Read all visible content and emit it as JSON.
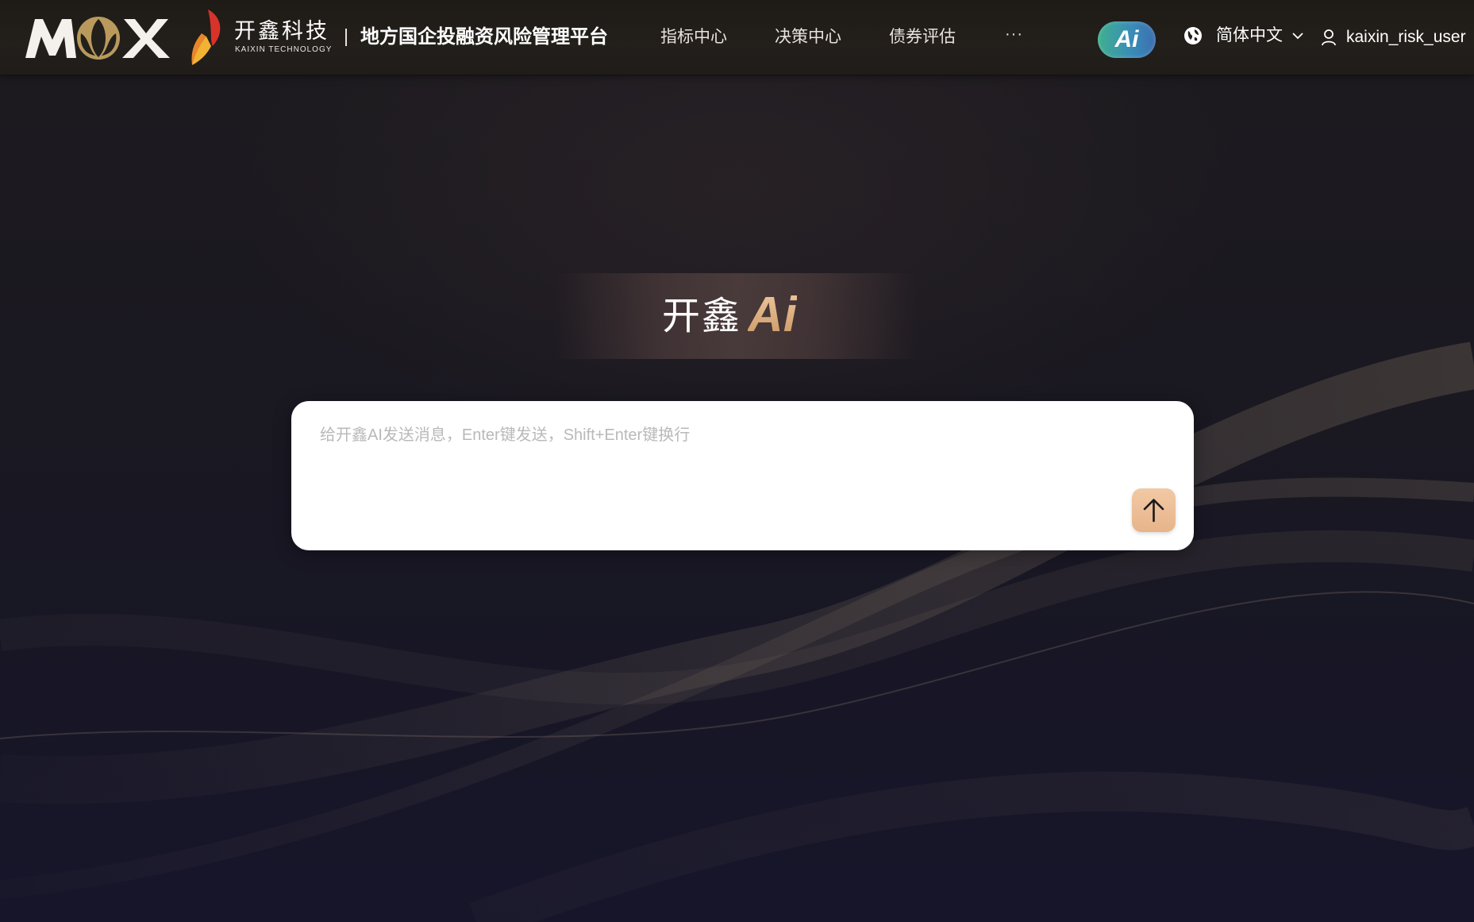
{
  "header": {
    "logo_text": "MOX",
    "company_cn": "开鑫科技",
    "company_en": "KAIXIN TECHNOLOGY",
    "platform_title": "地方国企投融资风险管理平台",
    "nav": [
      {
        "label": "指标中心"
      },
      {
        "label": "决策中心"
      },
      {
        "label": "债券评估"
      }
    ],
    "more_label": "···",
    "ai_badge": "Ai",
    "language": "简体中文",
    "username": "kaixin_risk_user"
  },
  "brand": {
    "name_cn": "开鑫",
    "name_ai": "Ai"
  },
  "chat": {
    "placeholder": "给开鑫AI发送消息，Enter键发送，Shift+Enter键换行",
    "value": ""
  },
  "colors": {
    "header_bg": "#221e1a",
    "page_bg": "#1a1720",
    "accent_gold": "#d7a97a",
    "send_button": "#eab890",
    "ai_badge_gradient_start": "#3fb08e",
    "ai_badge_gradient_end": "#3b6fb0"
  },
  "icons": {
    "globe": "globe-icon",
    "chevron": "chevron-down-icon",
    "user": "user-icon",
    "send": "arrow-up-icon"
  }
}
